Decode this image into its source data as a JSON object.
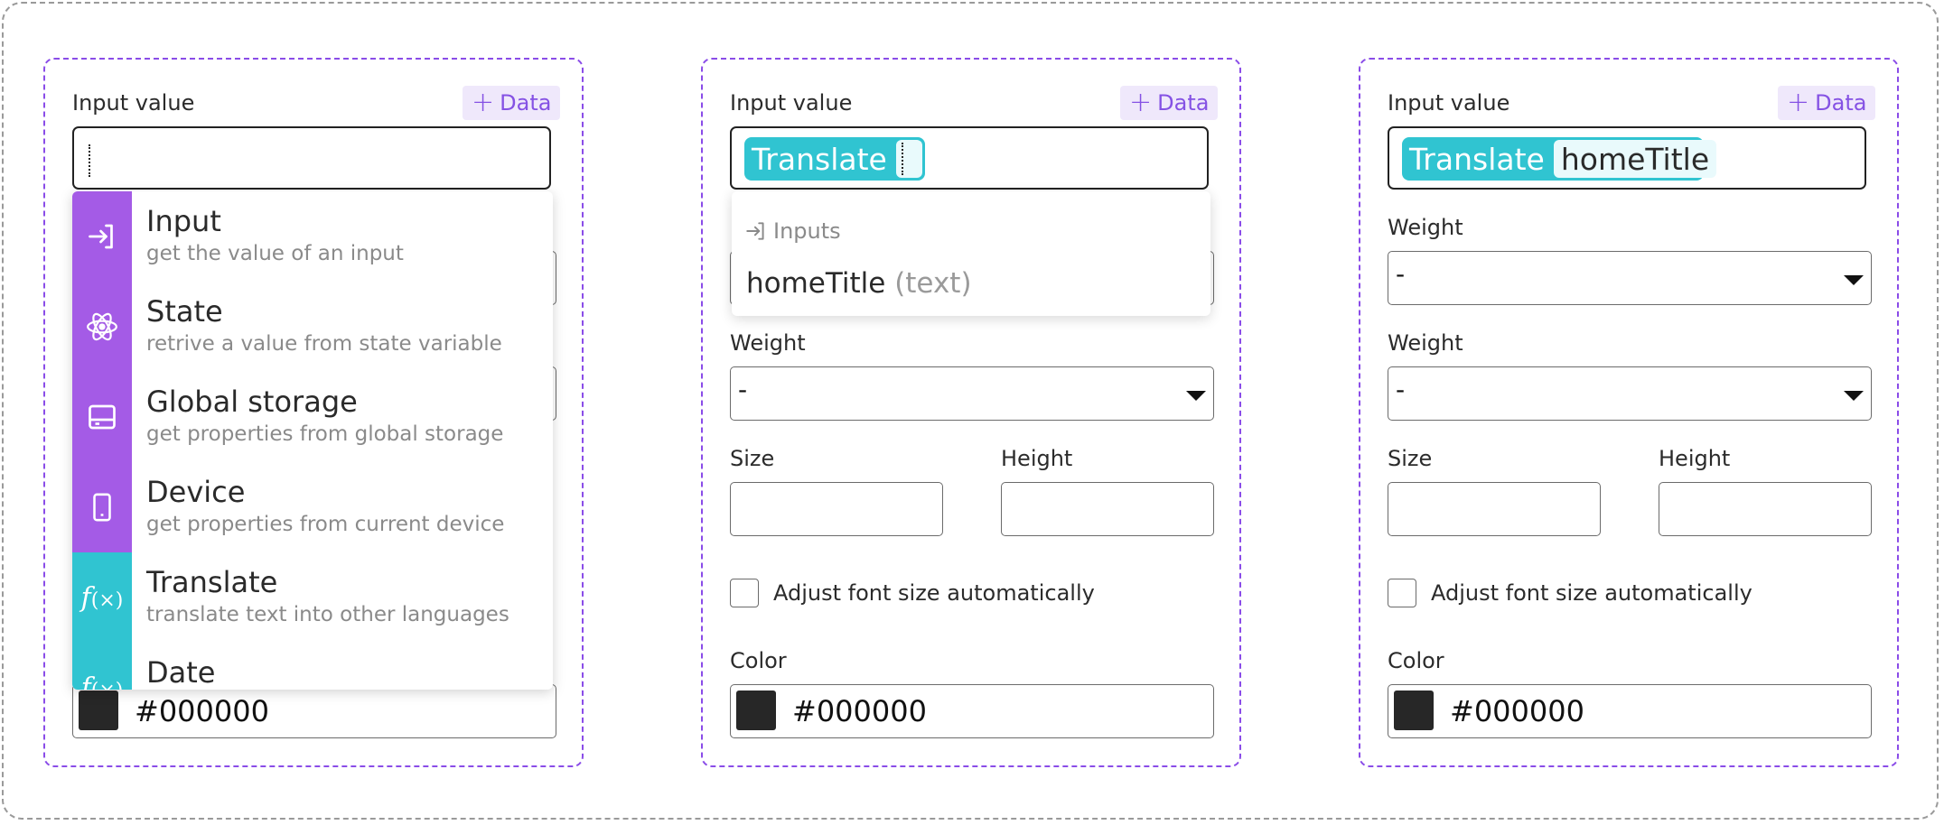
{
  "panels": [
    {
      "input_label": "Input value",
      "data_button": "Data",
      "dropdown_items": [
        {
          "title": "Input",
          "desc": "get the value of an input",
          "icon": "login-arrow-icon",
          "color": "#a45be6"
        },
        {
          "title": "State",
          "desc": "retrive a value from state variable",
          "icon": "atom-icon",
          "color": "#a45be6"
        },
        {
          "title": "Global storage",
          "desc": "get properties from global storage",
          "icon": "storage-drive-icon",
          "color": "#a45be6"
        },
        {
          "title": "Device",
          "desc": "get properties from current device",
          "icon": "mobile-device-icon",
          "color": "#a45be6"
        },
        {
          "title": "Translate",
          "desc": "translate text into other languages",
          "icon": "function-icon",
          "color": "#30c4d1"
        },
        {
          "title": "Date",
          "desc": "",
          "icon": "function-icon",
          "color": "#30c4d1"
        }
      ],
      "color_value": "#000000"
    },
    {
      "input_label": "Input value",
      "data_button": "Data",
      "chip_label": "Translate",
      "suggest_header": "Inputs",
      "suggest_item_name": "homeTitle",
      "suggest_item_type": "(text)",
      "weight_label": "Weight",
      "weight_value": "-",
      "size_label": "Size",
      "height_label": "Height",
      "checkbox_label": "Adjust font size automatically",
      "color_label": "Color",
      "color_value": "#000000"
    },
    {
      "input_label": "Input value",
      "data_button": "Data",
      "chip_label": "Translate",
      "chip_arg": "homeTitle",
      "weight1_label": "Weight",
      "weight1_value": "-",
      "weight2_label": "Weight",
      "weight2_value": "-",
      "size_label": "Size",
      "height_label": "Height",
      "checkbox_label": "Adjust font size automatically",
      "color_label": "Color",
      "color_value": "#000000"
    }
  ],
  "colors": {
    "accent_purple": "#8a4ce8",
    "dropdown_purple": "#a45be6",
    "translate_teal": "#30c4d1",
    "swatch": "#272727"
  }
}
